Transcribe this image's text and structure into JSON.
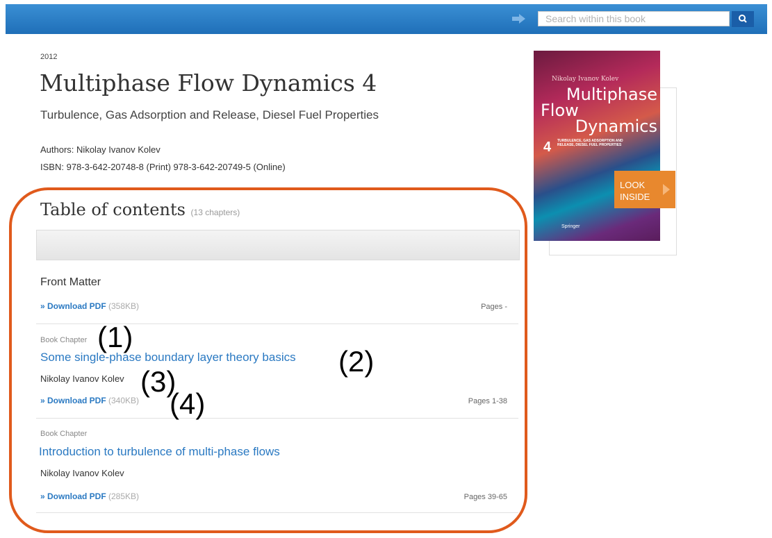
{
  "header": {
    "search_placeholder": "Search within this book"
  },
  "book": {
    "year": "2012",
    "title": "Multiphase Flow Dynamics 4",
    "subtitle": "Turbulence, Gas Adsorption and Release, Diesel Fuel Properties",
    "authors_label": "Authors:",
    "author": "Nikolay Ivanov Kolev",
    "isbn_label": "ISBN:",
    "isbn_print": "978-3-642-20748-8 (Print)",
    "isbn_online_num": "978-3-642-20749-5",
    "isbn_online_label": "(Online)"
  },
  "cover": {
    "author": "Nikolay Ivanov Kolev",
    "title_line1": "Multiphase",
    "title_line2": "Flow",
    "title_line3": "Dynamics",
    "number": "4",
    "subtitle": "TURBULENCE, GAS ADSORPTION AND RELEASE, DIESEL FUEL PROPERTIES",
    "publisher": "Springer",
    "look_inside_line1": "LOOK",
    "look_inside_line2": "INSIDE"
  },
  "toc": {
    "title": "Table of contents",
    "count": "(13 chapters)",
    "items": [
      {
        "type": "",
        "title": "Front Matter",
        "author": "",
        "download": "» Download PDF",
        "size": "(358KB)",
        "pages": "Pages -"
      },
      {
        "type": "Book Chapter",
        "title": "Some single-phase boundary layer theory basics",
        "author": "Nikolay Ivanov Kolev",
        "download": "» Download PDF",
        "size": "(340KB)",
        "pages": "Pages 1-38"
      },
      {
        "type": "Book Chapter",
        "title": "Introduction to turbulence of multi-phase flows",
        "author": "Nikolay Ivanov Kolev",
        "download": "» Download PDF",
        "size": "(285KB)",
        "pages": "Pages 39-65"
      }
    ]
  },
  "annotations": {
    "m1": "(1)",
    "m2": "(2)",
    "m3": "(3)",
    "m4": "(4)"
  },
  "colors": {
    "accent": "#2a79c2",
    "highlight": "#e05a1c",
    "look_inside": "#e8882e"
  }
}
